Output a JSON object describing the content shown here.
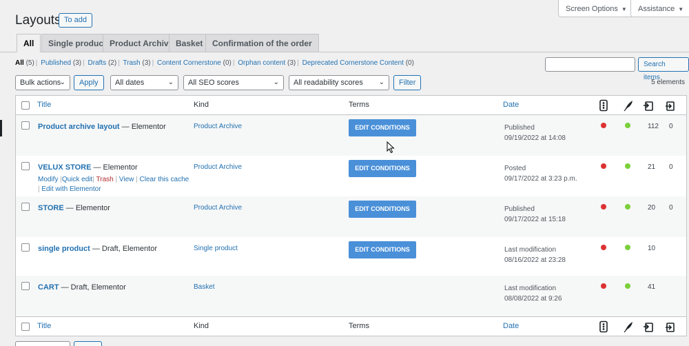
{
  "header": {
    "title": "Layouts",
    "add_label": "To add",
    "screen_options": "Screen Options",
    "assistance": "Assistance"
  },
  "tabs": [
    {
      "label": "All",
      "active": true
    },
    {
      "label": "Single product"
    },
    {
      "label": "Product Archive"
    },
    {
      "label": "Basket"
    },
    {
      "label": "Confirmation of the order"
    }
  ],
  "views": [
    {
      "label": "All",
      "count": "(5)"
    },
    {
      "label": "Published",
      "count": "(3)"
    },
    {
      "label": "Drafts",
      "count": "(2)"
    },
    {
      "label": "Trash",
      "count": "(3)"
    },
    {
      "label": "Content Cornerstone",
      "count": "(0)"
    },
    {
      "label": "Orphan content",
      "count": "(3)"
    },
    {
      "label": "Deprecated Cornerstone Content",
      "count": "(0)"
    }
  ],
  "search": {
    "button": "Search items",
    "value": ""
  },
  "filters": {
    "bulk_actions": "Bulk actions",
    "apply": "Apply",
    "dates": "All dates",
    "seo": "All SEO scores",
    "readability": "All readability scores",
    "filter": "Filter",
    "items_count": "5 elements"
  },
  "table": {
    "columns": {
      "title": "Title",
      "kind": "Kind",
      "terms": "Terms",
      "date": "Date"
    },
    "edit_label": "EDIT CONDITIONS",
    "rows": [
      {
        "title": "Product archive layout",
        "suffix": " — Elementor",
        "kind": "Product Archive",
        "status": "Published",
        "date": "09/19/2022 at 14:08",
        "n1": "112",
        "n2": "0"
      },
      {
        "title": "VELUX STORE",
        "suffix": " — Elementor",
        "kind": "Product Archive",
        "status": "Posted",
        "date": "09/17/2022 at 3:23 p.m.",
        "n1": "21",
        "n2": "0",
        "actions": {
          "modify": "Modify",
          "quick_edit": "Quick edit",
          "trash": "Trash",
          "view": "View",
          "clear_cache": "Clear this cache",
          "edit_elementor": "Edit with Elementor"
        }
      },
      {
        "title": "STORE",
        "suffix": " — Elementor",
        "kind": "Product Archive",
        "status": "Published",
        "date": "09/17/2022 at 15:18",
        "n1": "20",
        "n2": "0"
      },
      {
        "title": "single product",
        "suffix": " — Draft, Elementor",
        "kind": "Single product",
        "status": "Last modification",
        "date": "08/16/2022 at 23:28",
        "n1": "10",
        "n2": ""
      },
      {
        "title": "CART",
        "suffix": " — Draft, Elementor",
        "kind": "Basket",
        "status": "Last modification",
        "date": "08/08/2022 at 9:26",
        "n1": "41",
        "n2": ""
      }
    ]
  },
  "colors": {
    "seo_dot": "#dc3232",
    "readability_dot": "#7ad03a",
    "accent": "#2271b1",
    "edit_button": "#4a90d9"
  }
}
